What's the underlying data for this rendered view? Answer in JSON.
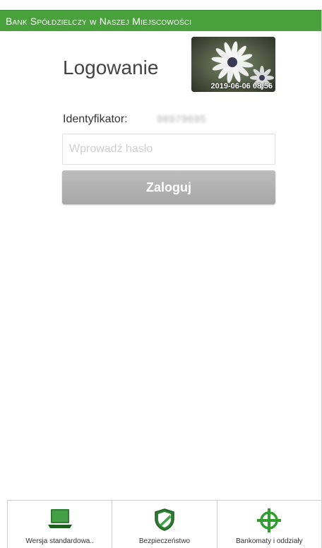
{
  "header": {
    "title": "Bank Spółdzielczy w Naszej Miejscowości"
  },
  "login": {
    "title": "Logowanie",
    "image_timestamp": "2019-06-06 08:56",
    "identifier_label": "Identyfikator:",
    "identifier_value": "98979695",
    "password_placeholder": "Wprowadź hasło",
    "submit_label": "Zaloguj"
  },
  "bottom_nav": [
    {
      "label": "Wersja standardowa..",
      "icon": "laptop-icon"
    },
    {
      "label": "Bezpieczeństwo",
      "icon": "shield-icon"
    },
    {
      "label": "Bankomaty i oddziały",
      "icon": "crosshair-icon"
    }
  ],
  "colors": {
    "header_bg": "#48a13b",
    "button_bg": "#b3b3b3",
    "icon_green": "#2f9e2f"
  }
}
